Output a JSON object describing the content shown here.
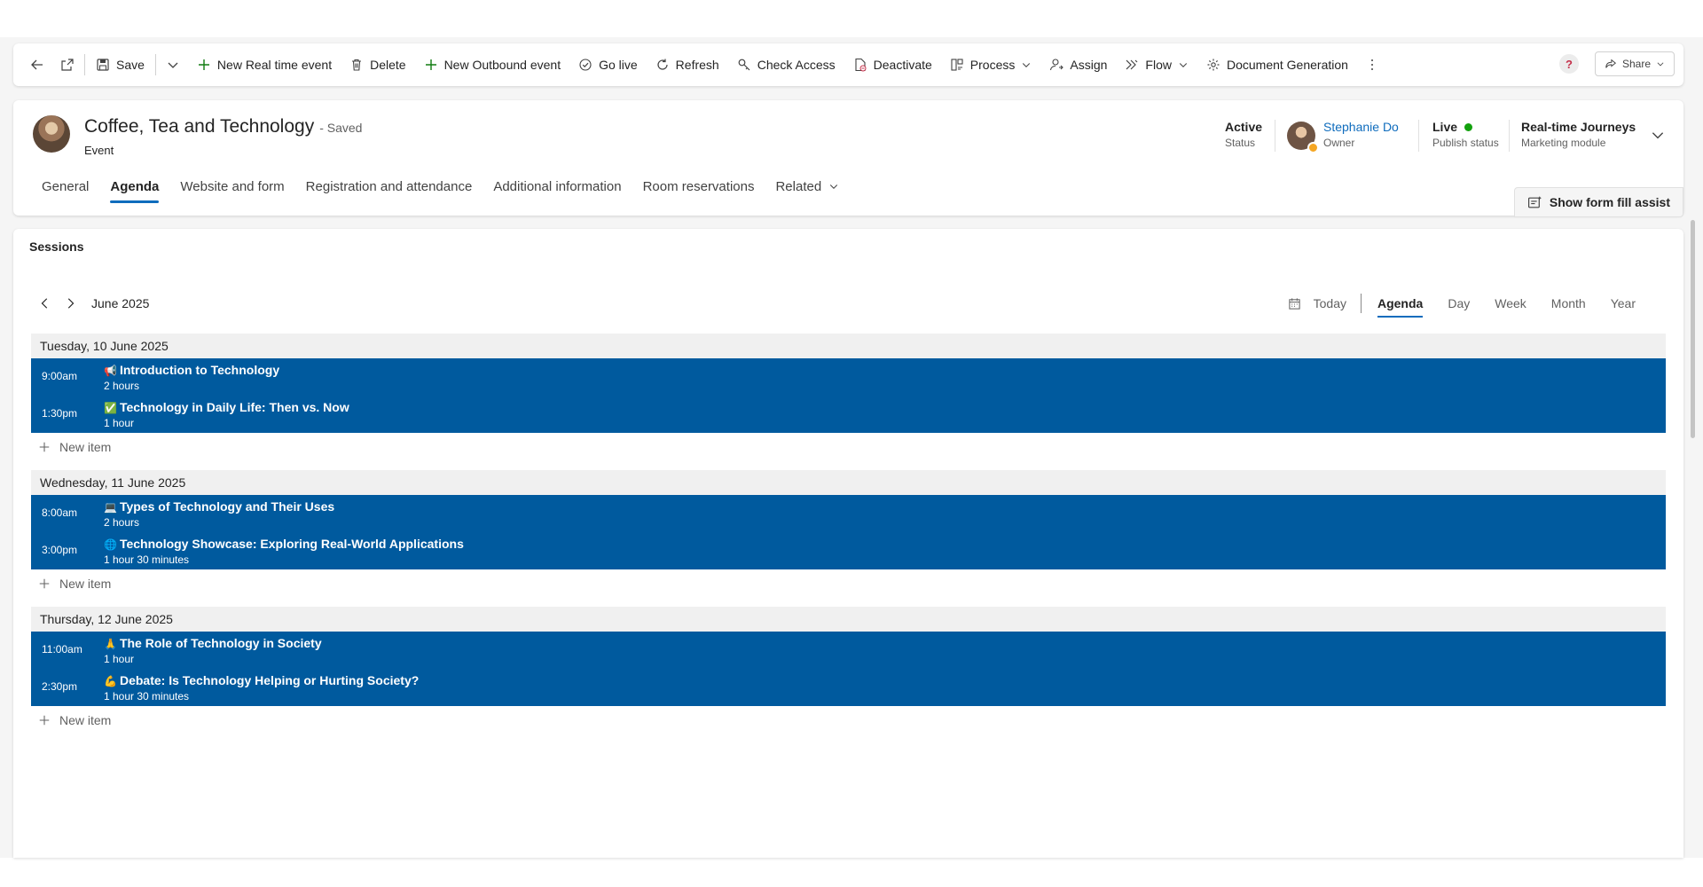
{
  "colors": {
    "accent": "#0f6cbd",
    "event_block": "#005a9e",
    "live_dot": "#13a10e"
  },
  "commandbar": {
    "icons": [
      "back-icon",
      "popout-icon"
    ],
    "save": "Save",
    "new_realtime_event": "New Real time event",
    "delete": "Delete",
    "new_outbound_event": "New Outbound event",
    "go_live": "Go live",
    "refresh": "Refresh",
    "check_access": "Check Access",
    "deactivate": "Deactivate",
    "process": "Process",
    "assign": "Assign",
    "flow": "Flow",
    "document_generation": "Document Generation",
    "help": "?",
    "share": "Share"
  },
  "record": {
    "title": "Coffee, Tea and Technology",
    "saved_state": "- Saved",
    "entity": "Event",
    "status_value": "Active",
    "status_label": "Status",
    "owner_name": "Stephanie Do",
    "owner_label": "Owner",
    "publish_value": "Live",
    "publish_label": "Publish status",
    "module_value": "Real-time Journeys",
    "module_label": "Marketing module"
  },
  "tabs": [
    {
      "label": "General"
    },
    {
      "label": "Agenda"
    },
    {
      "label": "Website and form"
    },
    {
      "label": "Registration and attendance"
    },
    {
      "label": "Additional information"
    },
    {
      "label": "Room reservations"
    },
    {
      "label": "Related"
    }
  ],
  "active_tab": "Agenda",
  "form_fill": "Show form fill assist",
  "sessions": {
    "title": "Sessions",
    "month": "June 2025",
    "views": {
      "today": "Today",
      "agenda": "Agenda",
      "day": "Day",
      "week": "Week",
      "month": "Month",
      "year": "Year"
    },
    "active_view": "Agenda",
    "new_item": "New item",
    "days": [
      {
        "date": "Tuesday, 10 June 2025",
        "events": [
          {
            "time": "9:00am",
            "emoji": "📢",
            "title": "Introduction to Technology",
            "duration": "2 hours"
          },
          {
            "time": "1:30pm",
            "emoji": "✅",
            "title": "Technology in Daily Life: Then vs. Now",
            "duration": "1 hour"
          }
        ]
      },
      {
        "date": "Wednesday, 11 June 2025",
        "events": [
          {
            "time": "8:00am",
            "emoji": "💻",
            "title": "Types of Technology and Their Uses",
            "duration": "2 hours"
          },
          {
            "time": "3:00pm",
            "emoji": "🌐",
            "title": "Technology Showcase: Exploring Real-World Applications",
            "duration": "1 hour 30 minutes"
          }
        ]
      },
      {
        "date": "Thursday, 12 June 2025",
        "events": [
          {
            "time": "11:00am",
            "emoji": "🙏",
            "title": "The Role of Technology in Society",
            "duration": "1 hour"
          },
          {
            "time": "2:30pm",
            "emoji": "💪",
            "title": "Debate: Is Technology Helping or Hurting Society?",
            "duration": "1 hour 30 minutes"
          }
        ]
      }
    ]
  }
}
